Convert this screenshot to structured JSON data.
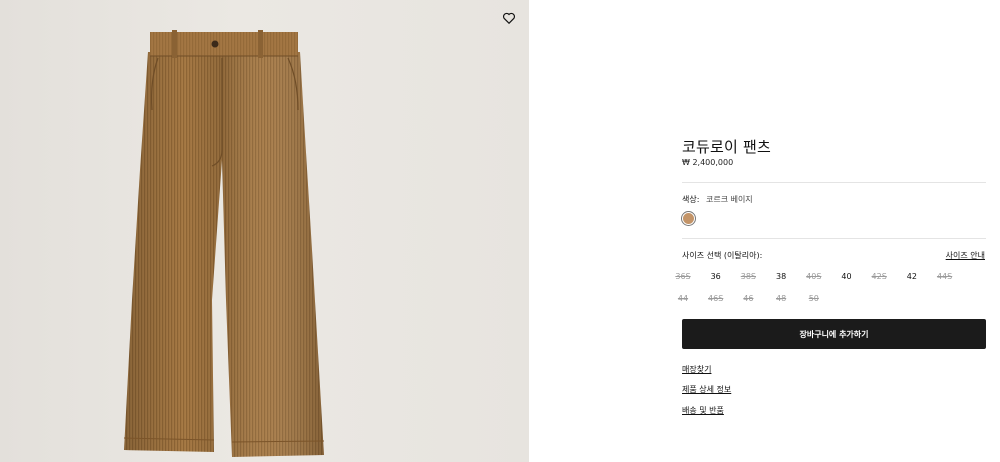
{
  "product": {
    "title": "코듀로이 팬츠",
    "price": "₩ 2,400,000"
  },
  "color": {
    "label": "색상:",
    "value": "코르크 베이지",
    "swatch_hex": "#c39468"
  },
  "size": {
    "label": "사이즈 선택 (이탈리아):",
    "guide_link": "사이즈 안내",
    "options": [
      {
        "label": "36S",
        "available": false
      },
      {
        "label": "36",
        "available": true
      },
      {
        "label": "38S",
        "available": false
      },
      {
        "label": "38",
        "available": true
      },
      {
        "label": "40S",
        "available": false
      },
      {
        "label": "40",
        "available": true
      },
      {
        "label": "42S",
        "available": false
      },
      {
        "label": "42",
        "available": true
      },
      {
        "label": "44S",
        "available": false
      },
      {
        "label": "44",
        "available": false
      },
      {
        "label": "46S",
        "available": false
      },
      {
        "label": "46",
        "available": false
      },
      {
        "label": "48",
        "available": false
      },
      {
        "label": "50",
        "available": false
      }
    ]
  },
  "actions": {
    "add_to_cart": "장바구니에 추가하기"
  },
  "links": {
    "store_finder": "매장찾기",
    "product_details": "제품 상세 정보",
    "shipping_returns": "배송 및 반품"
  },
  "icons": {
    "favorite": "heart-icon"
  }
}
